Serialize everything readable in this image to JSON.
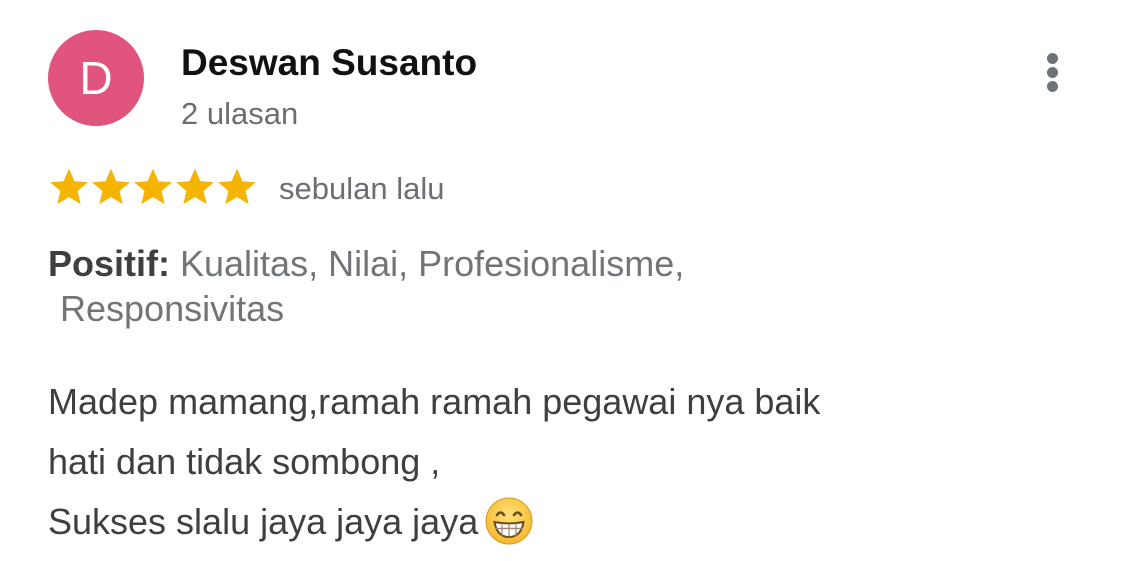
{
  "review": {
    "avatar_letter": "D",
    "avatar_color": "#e0547d",
    "author_name": "Deswan Susanto",
    "review_count": "2 ulasan",
    "rating": 5,
    "rating_max": 5,
    "star_color": "#f4b400",
    "time": "sebulan lalu",
    "positive_label": "Positif:",
    "positive_values_line1": " Kualitas, Nilai, Profesionalisme,",
    "positive_values_line2": "Responsivitas",
    "text_lines": [
      "Madep mamang,ramah ramah pegawai nya baik",
      "hati dan tidak sombong ,",
      "Sukses slalu jaya jaya jaya"
    ],
    "emoji": "grinning-face-with-smiling-eyes-icon",
    "more_menu_icon": "more-vertical-icon"
  }
}
